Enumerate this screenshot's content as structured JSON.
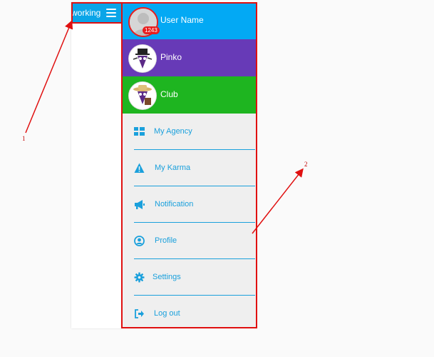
{
  "app": {
    "title_fragment": "working"
  },
  "drawer": {
    "profiles": [
      {
        "label": "User Name",
        "badge": "1243",
        "color": "#03a9f4"
      },
      {
        "label": "Pinko",
        "color": "#673ab7"
      },
      {
        "label": "Club",
        "color": "#1eb520"
      }
    ],
    "menu": [
      {
        "label": "My Agency",
        "icon": "grid-icon"
      },
      {
        "label": "My Karma",
        "icon": "warning-icon"
      },
      {
        "label": "Notification",
        "icon": "megaphone-icon"
      },
      {
        "label": "Profile",
        "icon": "user-circle-icon"
      },
      {
        "label": "Settings",
        "icon": "gear-icon"
      },
      {
        "label": "Log out",
        "icon": "logout-icon"
      }
    ],
    "accent": "#1aa0dc"
  },
  "annotations": {
    "label_1": "1",
    "label_2": "2",
    "color": "#e01010"
  }
}
